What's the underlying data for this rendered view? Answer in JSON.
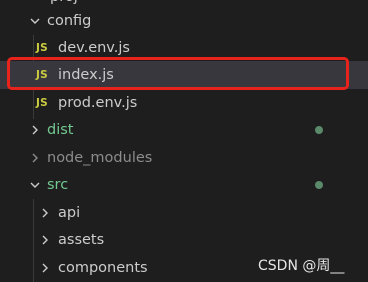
{
  "colors": {
    "background": "#1e1e1e",
    "text": "#cccccc",
    "muted_text": "#8c8c8c",
    "green_text": "#73c991",
    "js_badge": "#cbcb41",
    "selection_bg": "#37373d",
    "highlight_border": "#e8231b",
    "git_dot": "#5a8a6a"
  },
  "explorer": {
    "top_clipped_text": "proj",
    "items": [
      {
        "label": "config",
        "type": "folder",
        "expanded": true,
        "icon": "chevron-down-icon"
      },
      {
        "label": "dev.env.js",
        "type": "file",
        "icon": "js-file-icon",
        "badge": "JS"
      },
      {
        "label": "index.js",
        "type": "file",
        "icon": "js-file-icon",
        "badge": "JS",
        "selected": true
      },
      {
        "label": "prod.env.js",
        "type": "file",
        "icon": "js-file-icon",
        "badge": "JS"
      },
      {
        "label": "dist",
        "type": "folder",
        "expanded": false,
        "icon": "chevron-right-icon",
        "status": "untracked"
      },
      {
        "label": "node_modules",
        "type": "folder",
        "expanded": false,
        "icon": "chevron-right-icon",
        "status": "ignored"
      },
      {
        "label": "src",
        "type": "folder",
        "expanded": true,
        "icon": "chevron-down-icon",
        "status": "untracked"
      },
      {
        "label": "api",
        "type": "folder",
        "expanded": false,
        "icon": "chevron-right-icon"
      },
      {
        "label": "assets",
        "type": "folder",
        "expanded": false,
        "icon": "chevron-right-icon"
      },
      {
        "label": "components",
        "type": "folder",
        "expanded": false,
        "icon": "chevron-right-icon"
      }
    ]
  },
  "watermark": "CSDN @周__"
}
